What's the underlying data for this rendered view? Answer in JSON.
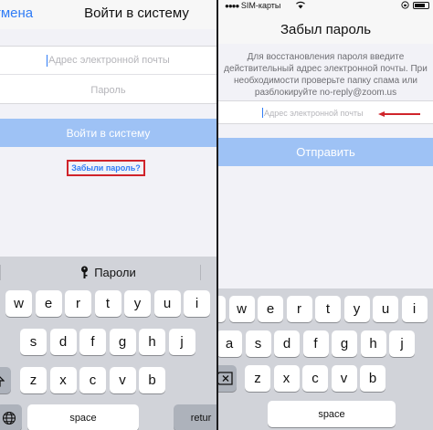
{
  "left": {
    "nav": {
      "cancel": "тмена",
      "title": "Войти в систему"
    },
    "form": {
      "email_placeholder": "Адрес электронной почты",
      "password_placeholder": "Пароль",
      "login_button": "Войти в систему",
      "forgot_link": "Забыли пароль?"
    },
    "keyboard": {
      "suggestion": "Пароли",
      "row1": [
        "w",
        "e",
        "r",
        "t",
        "y",
        "u",
        "i"
      ],
      "row2": [
        "s",
        "d",
        "f",
        "g",
        "h",
        "j"
      ],
      "row3": [
        "z",
        "x",
        "c",
        "v",
        "b"
      ],
      "space": "space",
      "return": "retur"
    }
  },
  "right": {
    "statusbar": {
      "carrier": "SIM-карты"
    },
    "nav": {
      "title": "Забыл пароль"
    },
    "hint": "Для восстановления пароля введите действительный адрес электронной почты. При необходимости проверьте папку спама или разблокируйте no-reply@zoom.us",
    "email_placeholder": "Адрес электронной почты",
    "send_button": "Отправить",
    "keyboard": {
      "row1": [
        "q",
        "w",
        "e",
        "r",
        "t",
        "y",
        "u",
        "i"
      ],
      "row2": [
        "a",
        "s",
        "d",
        "f",
        "g",
        "h",
        "j"
      ],
      "row3": [
        "z",
        "x",
        "c",
        "v",
        "b"
      ],
      "space": "space"
    }
  },
  "colors": {
    "accent": "#2f7cf6",
    "button_disabled": "#9ec2f5",
    "highlight": "#d0242b"
  }
}
